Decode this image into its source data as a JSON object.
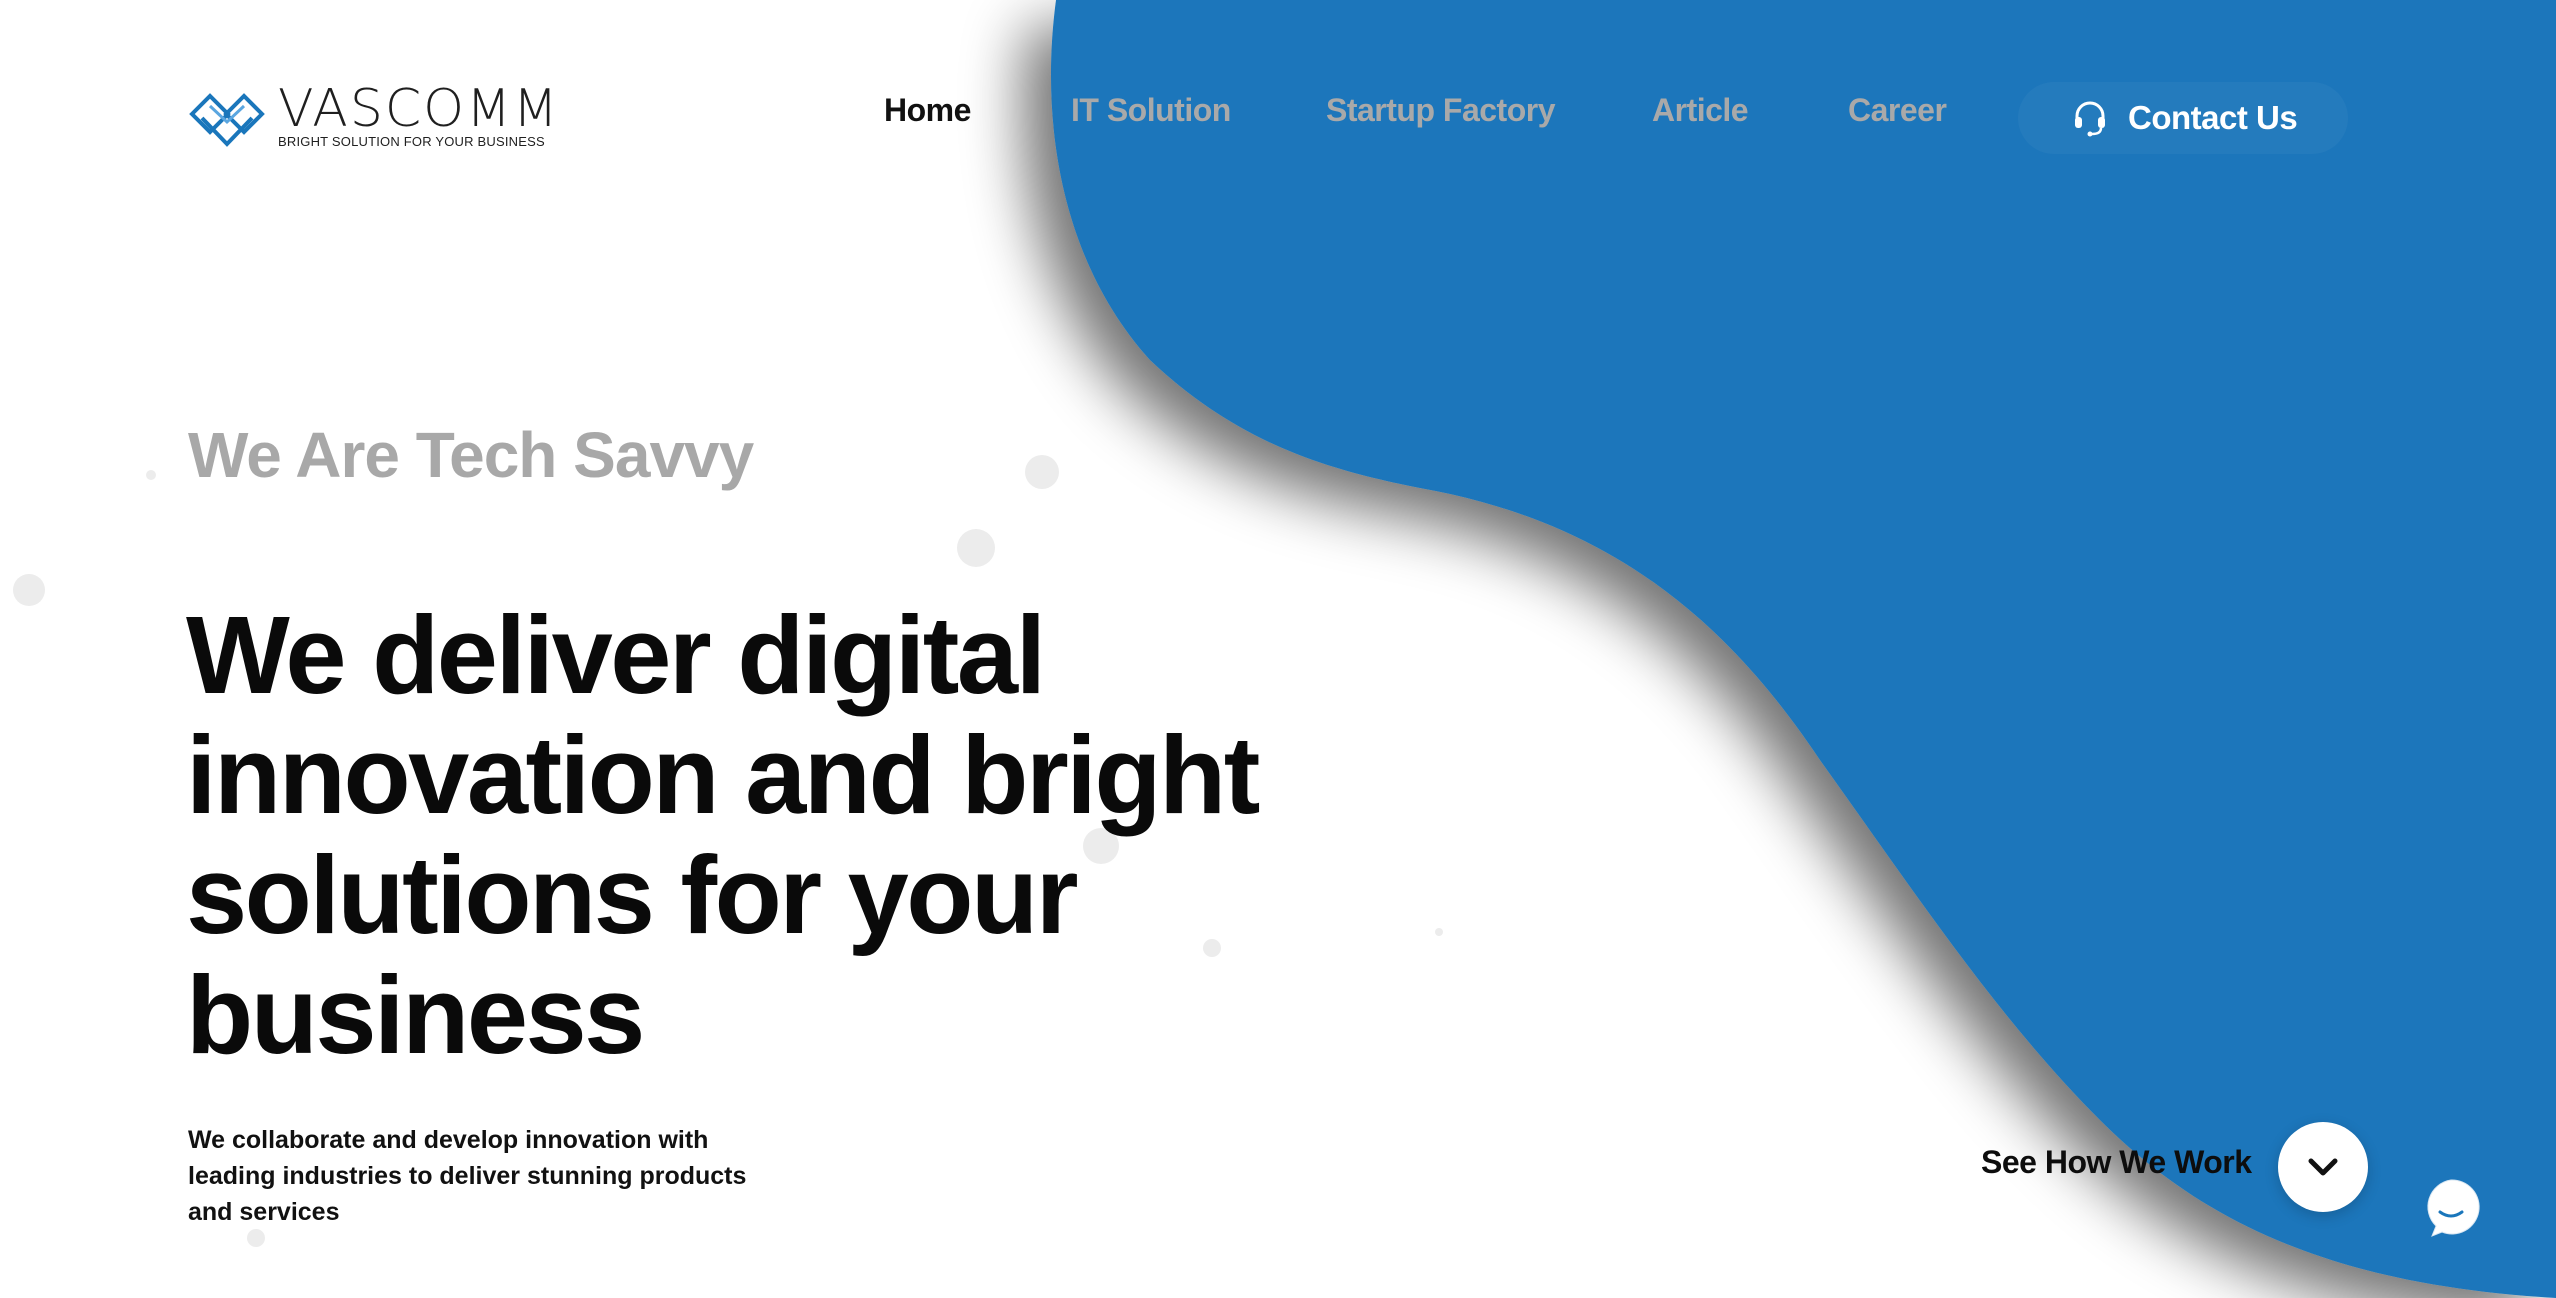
{
  "brand": {
    "name": "VASCOMM",
    "tagline": "BRIGHT SOLUTION FOR YOUR BUSINESS"
  },
  "nav": {
    "items": [
      {
        "label": "Home",
        "active": true
      },
      {
        "label": "IT Solution",
        "active": false
      },
      {
        "label": "Startup Factory",
        "active": false
      },
      {
        "label": "Article",
        "active": false
      },
      {
        "label": "Career",
        "active": false
      }
    ],
    "contact": {
      "label": "Contact Us",
      "icon": "headset-icon"
    }
  },
  "hero": {
    "eyebrow": "We Are Tech Savvy",
    "headline": "We deliver digital innovation and bright solutions for your business",
    "lead": "We collaborate and develop innovation with leading industries to deliver stunning products and services",
    "see_how": "See How We Work",
    "scroll_icon": "chevron-down-icon",
    "chat_icon": "chat-bubble-icon"
  },
  "colors": {
    "accent_blue": "#1a76bb",
    "text_dark": "#0a0a0a",
    "text_muted": "#a9a9a9",
    "background": "#ffffff"
  }
}
